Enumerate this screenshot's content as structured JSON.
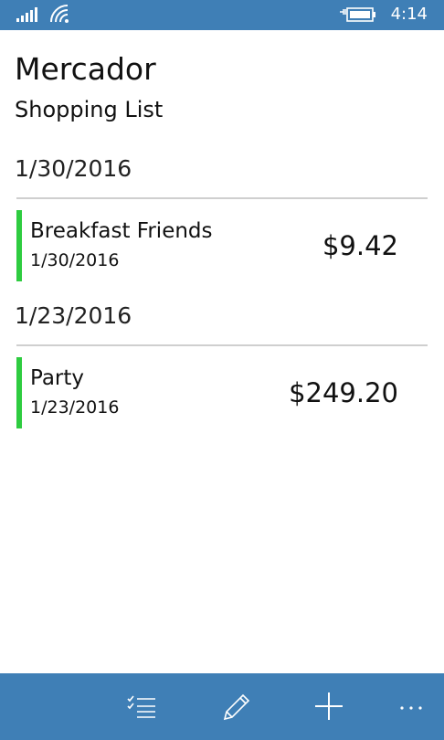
{
  "status_bar": {
    "time": "4:14",
    "signal_icon": "signal-bars-icon",
    "wifi_icon": "wifi-icon",
    "battery_icon": "battery-charging-icon"
  },
  "header": {
    "app_title": "Mercador",
    "page_subtitle": "Shopping List"
  },
  "groups": [
    {
      "date_header": "1/30/2016",
      "items": [
        {
          "name": "Breakfast Friends",
          "date": "1/30/2016",
          "total": "$9.42"
        }
      ]
    },
    {
      "date_header": "1/23/2016",
      "items": [
        {
          "name": "Party",
          "date": "1/23/2016",
          "total": "$249.20"
        }
      ]
    }
  ],
  "app_bar": {
    "buttons": [
      {
        "icon": "checklist-icon"
      },
      {
        "icon": "pencil-icon"
      },
      {
        "icon": "plus-icon"
      },
      {
        "icon": "more-ellipsis-icon"
      }
    ]
  },
  "colors": {
    "accent_bar": "#3f7fb6",
    "item_indicator": "#2ecc40",
    "divider": "#cfcfcf"
  }
}
